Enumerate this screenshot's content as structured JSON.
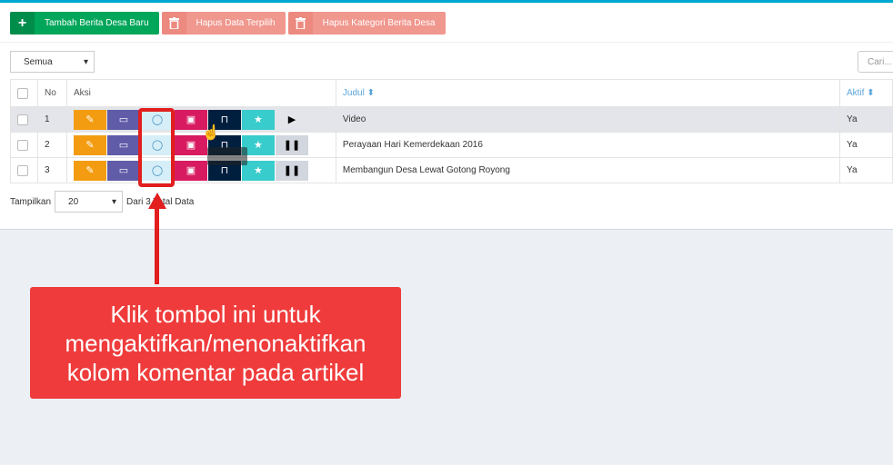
{
  "toolbar": {
    "add_label": "Tambah Berita Desa Baru",
    "delete_selected_label": "Hapus Data Terpilih",
    "delete_category_label": "Hapus Kategori Berita Desa"
  },
  "filter": {
    "selected": "Semua"
  },
  "search": {
    "placeholder": "Cari..."
  },
  "table": {
    "headers": {
      "no": "No",
      "aksi": "Aksi",
      "judul": "Judul",
      "aktif": "Aktif"
    },
    "rows": [
      {
        "no": "1",
        "judul": "Video",
        "aktif": "Ya"
      },
      {
        "no": "2",
        "judul": "Perayaan Hari Kemerdekaan 2016",
        "aktif": "Ya"
      },
      {
        "no": "3",
        "judul": "Membangun Desa Lewat Gotong Royong",
        "aktif": "Ya"
      }
    ]
  },
  "pagination": {
    "show_label": "Tampilkan",
    "per_page": "20",
    "total_text": "Dari 3 Total Data"
  },
  "callout": {
    "text": "Klik tombol ini untuk mengaktifkan/menonaktifkan kolom komentar pada artikel"
  },
  "colors": {
    "accent": "#00a65a",
    "danger": "#f0978e",
    "callout": "#ef3b3b",
    "highlight": "#e21e1e"
  }
}
